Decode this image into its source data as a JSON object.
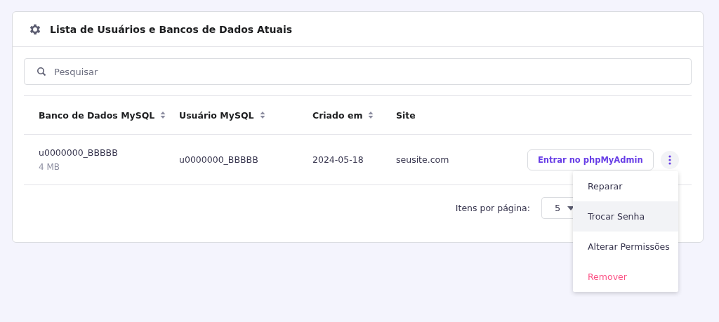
{
  "card": {
    "title": "Lista de Usuários e Bancos de Dados Atuais"
  },
  "search": {
    "placeholder": "Pesquisar"
  },
  "table": {
    "columns": [
      {
        "label": "Banco de Dados MySQL",
        "sortable": true
      },
      {
        "label": "Usuário MySQL",
        "sortable": true
      },
      {
        "label": "Criado em",
        "sortable": true
      },
      {
        "label": "Site",
        "sortable": false
      }
    ],
    "rows": [
      {
        "database": "u0000000_BBBBB",
        "size": "4 MB",
        "user": "u0000000_BBBBB",
        "created": "2024-05-18",
        "site": "seusite.com",
        "action": "Entrar no phpMyAdmin"
      }
    ]
  },
  "pagination": {
    "label": "Itens por página:",
    "value": "5"
  },
  "menu": {
    "items": [
      {
        "label": "Reparar",
        "kind": "normal",
        "selected": false
      },
      {
        "label": "Trocar Senha",
        "kind": "normal",
        "selected": true
      },
      {
        "label": "Alterar Permissões",
        "kind": "normal",
        "selected": false
      },
      {
        "label": "Remover",
        "kind": "danger",
        "selected": false
      }
    ]
  }
}
